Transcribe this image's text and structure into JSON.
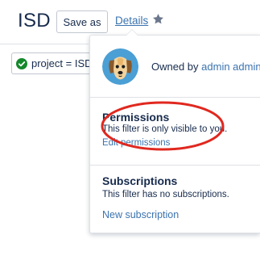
{
  "header": {
    "title": "ISD",
    "save_as_label": "Save as",
    "details_label": "Details",
    "star_icon": "star-icon"
  },
  "query": {
    "text": "project = ISD",
    "status_icon": "valid-check-icon",
    "status_color": "#14892c"
  },
  "details_popup": {
    "owner": {
      "prefix": "Owned by ",
      "name": "admin admin",
      "avatar_icon": "dog-avatar"
    },
    "permissions": {
      "heading": "Permissions",
      "text": "This filter is only visible to you.",
      "link": "Edit permissions"
    },
    "subscriptions": {
      "heading": "Subscriptions",
      "text": "This filter has no subscriptions.",
      "link": "New subscription"
    }
  },
  "colors": {
    "link": "#3b73af",
    "text": "#172b4d",
    "annotation": "#e0281f",
    "avatar_bg": "#4a9fd5"
  }
}
